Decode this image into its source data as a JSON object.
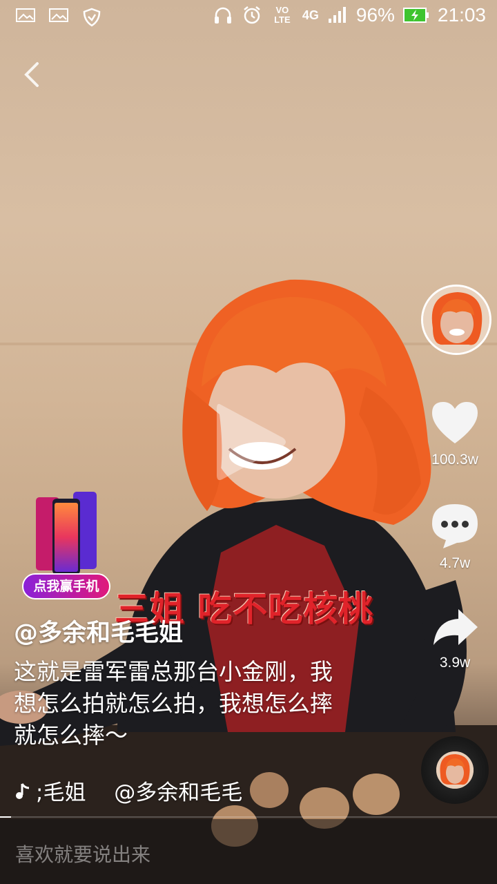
{
  "status_bar": {
    "battery": "96%",
    "time": "21:03",
    "network": "4G",
    "volte": "VO LTE"
  },
  "video": {
    "subtitle": "三姐 吃不吃核桃"
  },
  "promo": {
    "label": "点我赢手机"
  },
  "actions": {
    "likes": "100.3w",
    "comments": "4.7w",
    "shares": "3.9w"
  },
  "caption": {
    "author": "@多余和毛毛姐",
    "description": "这就是雷军雷总那台小金刚，我想怎么拍就怎么拍，我想怎么摔就怎么摔～",
    "music": ";毛姐　 @多余和毛毛"
  },
  "comment": {
    "placeholder": "喜欢就要说出来"
  },
  "colors": {
    "subtitle": "#e0232a",
    "promo_gradient_start": "#8a21d8",
    "promo_gradient_end": "#e0197a",
    "battery_fill": "#3fc42f"
  }
}
